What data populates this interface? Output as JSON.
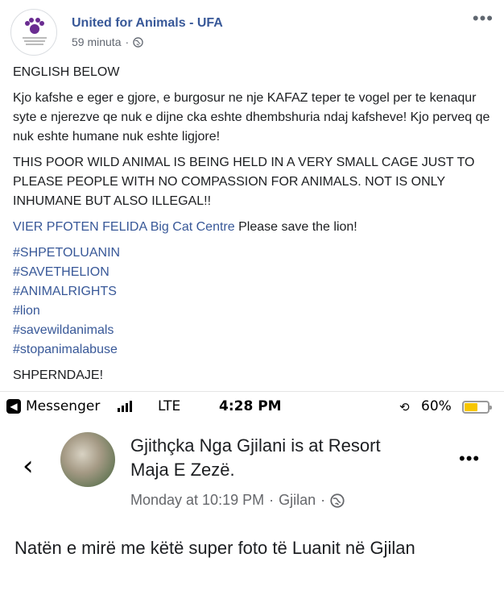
{
  "post": {
    "page_name": "United for Animals - UFA",
    "time": "59 minuta",
    "separator": "·",
    "privacy_icon": "globe-icon",
    "more_icon": "more-options-icon",
    "more_label": "•••",
    "paragraphs": {
      "p1": "ENGLISH BELOW",
      "p2": "Kjo kafshe e eger e gjore, e burgosur ne nje KAFAZ teper te vogel per te kenaqur syte e njerezve qe nuk e dijne cka eshte dhembshuria ndaj kafsheve! Kjo perveq qe nuk eshte humane nuk eshte ligjore!",
      "p3": "THIS POOR WILD ANIMAL IS BEING HELD IN A VERY SMALL CAGE JUST TO PLEASE PEOPLE WITH NO COMPASSION FOR ANIMALS. NOT IS ONLY INHUMANE BUT ALSO ILLEGAL!!",
      "p4_link": "VIER PFOTEN FELIDA Big Cat Centre",
      "p4_rest": " Please save the lion!",
      "p5": "SHPERNDAJE!"
    },
    "hashtags": [
      "#SHPETOLUANIN",
      "#SAVETHELION",
      "#ANIMALRIGHTS",
      "#lion",
      "#savewildanimals",
      "#stopanimalabuse"
    ],
    "colors": {
      "link": "#385898",
      "text": "#1c1e21",
      "meta": "#616770"
    }
  },
  "screenshot": {
    "status_bar": {
      "back_app": "Messenger",
      "network": "LTE",
      "time": "4:28 PM",
      "battery": "60%",
      "lock_icon": "rotation-lock-icon",
      "battery_level": 0.6
    },
    "inner_post": {
      "author": "Gjithçka Nga Gjilani",
      "connector": " is at ",
      "location": "Resort Maja E Zezë.",
      "time": "Monday at 10:19 PM",
      "place": "Gjilan",
      "text": "Natën e mirë me këtë super foto të Luanit në Gjilan"
    }
  }
}
